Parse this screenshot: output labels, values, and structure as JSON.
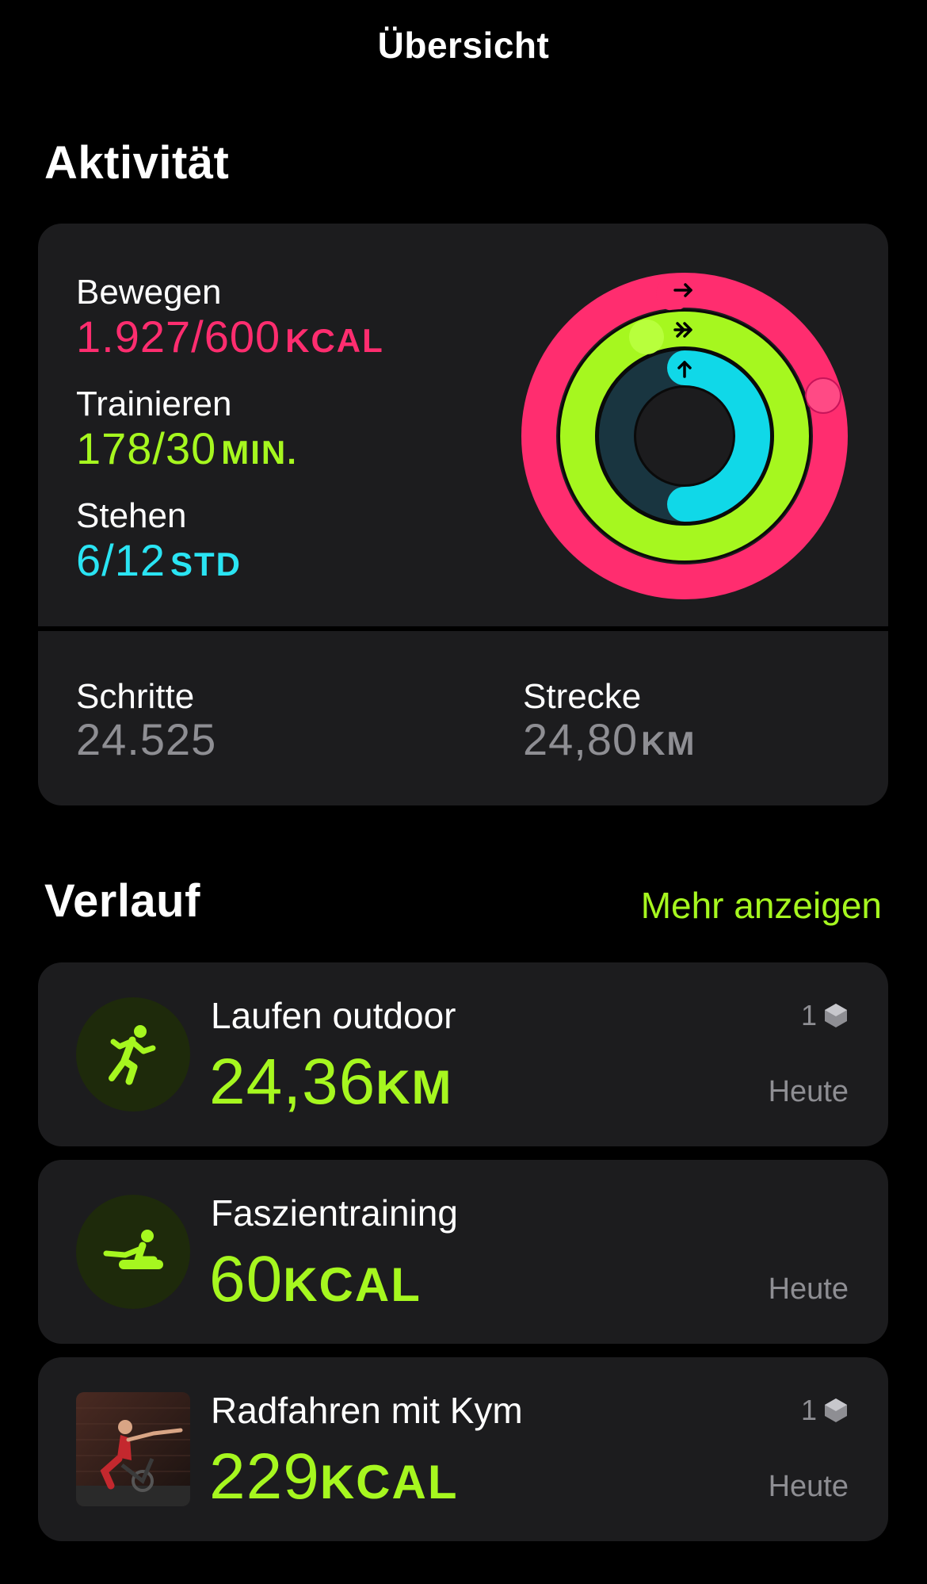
{
  "nav": {
    "title": "Übersicht"
  },
  "activity": {
    "title": "Aktivität",
    "move": {
      "label": "Bewegen",
      "value": "1.927/600",
      "unit": "KCAL",
      "progress": 3.21,
      "color": "#ff2d6f"
    },
    "exercise": {
      "label": "Trainieren",
      "value": "178/30",
      "unit": "MIN.",
      "progress": 5.93,
      "color": "#a6f71f"
    },
    "stand": {
      "label": "Stehen",
      "value": "6/12",
      "unit": "STD",
      "progress": 0.5,
      "color": "#2ae4f3"
    },
    "steps": {
      "label": "Schritte",
      "value": "24.525"
    },
    "distance": {
      "label": "Strecke",
      "value": "24,80",
      "unit": "KM"
    }
  },
  "history": {
    "title": "Verlauf",
    "more_label": "Mehr anzeigen",
    "workouts": [
      {
        "name": "Laufen outdoor",
        "value": "24,36",
        "unit": "KM",
        "date": "Heute",
        "badge": "1",
        "icon": "running-icon"
      },
      {
        "name": "Faszientraining",
        "value": "60",
        "unit": "KCAL",
        "date": "Heute",
        "icon": "fascia-training-icon"
      },
      {
        "name": "Radfahren mit Kym",
        "value": "229",
        "unit": "KCAL",
        "date": "Heute",
        "badge": "1",
        "icon": "cycling-thumbnail"
      }
    ]
  }
}
